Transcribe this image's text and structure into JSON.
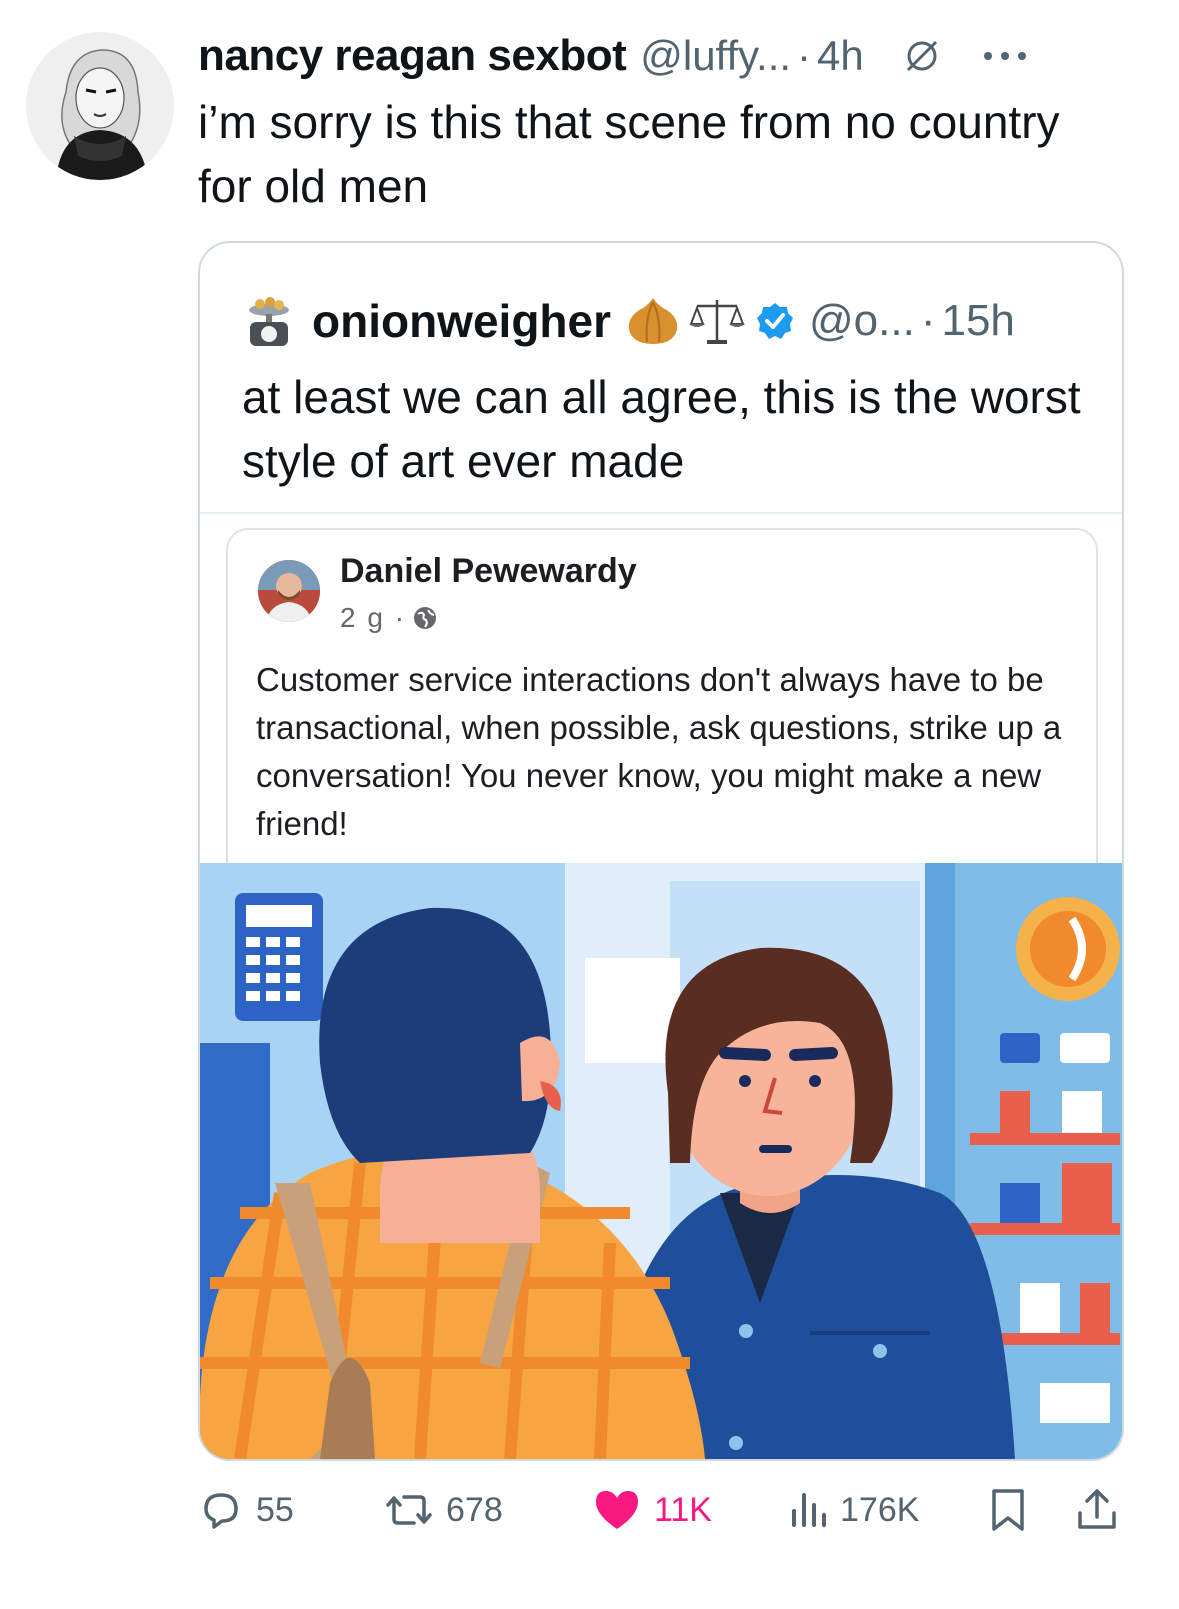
{
  "tweet": {
    "author_name": "nancy reagan sexbot",
    "handle": "@luffy...",
    "separator": "·",
    "time": "4h",
    "text": "i’m sorry is this that scene from no country for old men"
  },
  "quoted": {
    "author_name": "onionweigher",
    "handle": "@o...",
    "separator": "·",
    "time": "15h",
    "text": "at least we can all agree, this is the worst style of art ever made",
    "verified_color": "#1d9bf0"
  },
  "fb_post": {
    "author": "Daniel Pewewardy",
    "time": "2 g ·",
    "text": "Customer service interactions don't always have to be transactional, when possible, ask questions, strike up a conversation! You never know, you might make a new friend!"
  },
  "stats": {
    "replies": "55",
    "reposts": "678",
    "likes": "11K",
    "views": "176K"
  },
  "colors": {
    "like": "#f91880",
    "muted": "#536471",
    "border": "#cfd9de"
  }
}
